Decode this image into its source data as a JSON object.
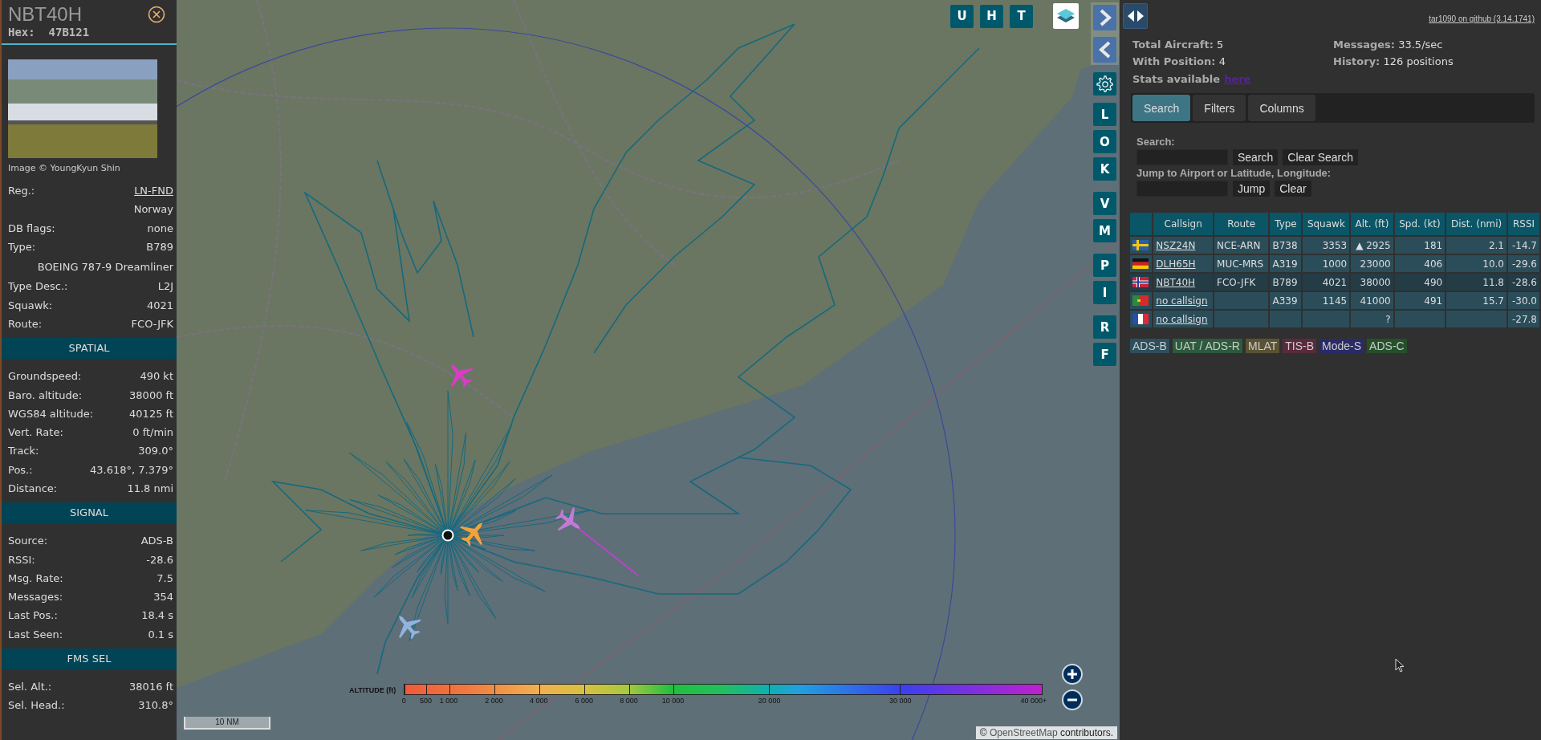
{
  "details": {
    "callsign": "NBT40H",
    "hex": "Hex:  47B121",
    "photo_credit": "Image © YoungKyun Shin",
    "rows": [
      {
        "kind": "link",
        "label": "Reg.:",
        "value": "LN-FND"
      },
      {
        "kind": "value",
        "value": "Norway"
      },
      {
        "kind": "pair",
        "label": "DB flags:",
        "value": "none"
      },
      {
        "kind": "pair",
        "label": "Type:",
        "value": "B789"
      },
      {
        "kind": "value",
        "value": "BOEING 787-9 Dreamliner"
      },
      {
        "kind": "pair",
        "label": "Type Desc.:",
        "value": "L2J"
      },
      {
        "kind": "pair",
        "label": "Squawk:",
        "value": "4021"
      },
      {
        "kind": "pair",
        "label": "Route:",
        "value": "FCO-JFK"
      }
    ],
    "sections": [
      {
        "title": "SPATIAL",
        "rows": [
          {
            "label": "Groundspeed:",
            "value": "490 kt"
          },
          {
            "label": "Baro. altitude:",
            "value": "38000 ft"
          },
          {
            "label": "WGS84 altitude:",
            "value": "40125 ft"
          },
          {
            "label": "Vert. Rate:",
            "value": "0 ft/min"
          },
          {
            "label": "Track:",
            "value": "309.0°"
          },
          {
            "label": "Pos.:",
            "value": "43.618°, 7.379°"
          },
          {
            "label": "Distance:",
            "value": "11.8 nmi"
          }
        ]
      },
      {
        "title": "SIGNAL",
        "rows": [
          {
            "label": "Source:",
            "value": "ADS-B"
          },
          {
            "label": "RSSI:",
            "value": "-28.6"
          },
          {
            "label": "Msg. Rate:",
            "value": "7.5"
          },
          {
            "label": "Messages:",
            "value": "354"
          },
          {
            "label": "Last Pos.:",
            "value": "18.4 s"
          },
          {
            "label": "Last Seen:",
            "value": "0.1 s"
          }
        ]
      },
      {
        "title": "FMS SEL",
        "rows": [
          {
            "label": "Sel. Alt.:",
            "value": "38016 ft"
          },
          {
            "label": "Sel. Head.:",
            "value": "310.8°"
          }
        ]
      }
    ]
  },
  "map": {
    "top_buttons": [
      "U",
      "H",
      "T"
    ],
    "side_groups": [
      [
        "L",
        "O",
        "K"
      ],
      [
        "V",
        "M"
      ],
      [
        "P",
        "I"
      ],
      [
        "R",
        "F"
      ]
    ],
    "aircraft": [
      {
        "color": "#d63ec4"
      },
      {
        "color": "#f2a33a"
      },
      {
        "color": "#c27ad6"
      },
      {
        "color": "#8fb4e0"
      }
    ],
    "legend": {
      "title": "ALTITUDE (ft)",
      "ticks": [
        "0",
        "500",
        "1 000",
        "2 000",
        "4 000",
        "6 000",
        "8 000",
        "10 000",
        "20 000",
        "30 000",
        "40 000+"
      ]
    },
    "scale": "10 NM",
    "attribution": {
      "prefix": "©",
      "link": "OpenStreetMap",
      "suffix": "contributors."
    }
  },
  "panel": {
    "version_link": "tar1090 on github (3.14.1741)",
    "stats": [
      "**Total Aircraft:** 5",
      "**Messages:** 33.5/sec",
      "**With Position:** 4",
      "**History:** 126 positions"
    ],
    "stats_note": "Stats available",
    "stats_link": "here",
    "tabs": [
      {
        "label": "Search",
        "selected": true
      },
      {
        "label": "Filters",
        "selected": false
      },
      {
        "label": "Columns",
        "selected": false
      }
    ],
    "search_label": "Search:",
    "search_buttons": [
      "Search",
      "Clear Search"
    ],
    "jump_label": "Jump to Airport or Latitude, Longitude:",
    "jump_buttons": [
      "Jump",
      "Clear"
    ],
    "table": {
      "columns": [
        "Callsign",
        "Route",
        "Type",
        "Squawk",
        "Alt. (ft)",
        "Spd. (kt)",
        "Dist. (nmi)",
        "RSSI"
      ],
      "rows": [
        {
          "kind": "sweden",
          "selected": false,
          "cells": [
            "NSZ24N",
            "NCE-ARN",
            "B738",
            "3353",
            "▲  2925",
            "181",
            "2.1",
            "-14.7"
          ]
        },
        {
          "kind": "germany",
          "selected": false,
          "cells": [
            "DLH65H",
            "MUC-MRS",
            "A319",
            "1000",
            "23000",
            "406",
            "10.0",
            "-29.6"
          ]
        },
        {
          "kind": "norway",
          "selected": true,
          "cells": [
            "NBT40H",
            "FCO-JFK",
            "B789",
            "4021",
            "38000",
            "490",
            "11.8",
            "-28.6"
          ]
        },
        {
          "kind": "portugal",
          "selected": false,
          "cells": [
            "no callsign",
            "",
            "A339",
            "1145",
            "41000",
            "491",
            "15.7",
            "-30.0"
          ]
        },
        {
          "kind": "france",
          "selected": false,
          "cells": [
            "no callsign",
            "",
            "",
            "",
            "?",
            "",
            "",
            "-27.8"
          ]
        }
      ]
    },
    "sources": [
      {
        "label": "ADS-B",
        "color": "#2c4f5c"
      },
      {
        "label": "UAT / ADS-R",
        "color": "#2b5a3c"
      },
      {
        "label": "MLAT",
        "color": "#5a5232"
      },
      {
        "label": "TIS-B",
        "color": "#5a2a3c"
      },
      {
        "label": "Mode-S",
        "color": "#2a2a66"
      },
      {
        "label": "ADS-C",
        "color": "#24502a"
      }
    ]
  }
}
